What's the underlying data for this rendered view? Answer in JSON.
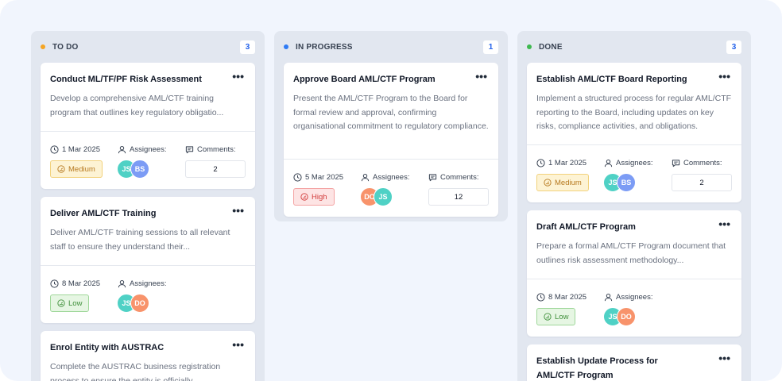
{
  "labels": {
    "assignees": "Assignees:",
    "comments": "Comments:"
  },
  "colors": {
    "todo": "#f5a524",
    "in_progress": "#2f7bf5",
    "done": "#3fb950",
    "avatar_js": "#4fd1c5",
    "avatar_bs": "#7c9cf5",
    "avatar_do": "#f8936b"
  },
  "columns": [
    {
      "title": "TO DO",
      "count": "3",
      "cards": [
        {
          "title": "Conduct ML/TF/PF Risk Assessment",
          "description": "Develop a comprehensive AML/CTF training program that outlines key regulatory obligatio...",
          "date": "1 Mar 2025",
          "priority": "Medium",
          "assignees": [
            "JS",
            "BS"
          ],
          "comments": "2"
        },
        {
          "title": "Deliver AML/CTF Training",
          "description": "Deliver AML/CTF training sessions to all relevant staff to ensure they understand their...",
          "date": "8 Mar 2025",
          "priority": "Low",
          "assignees": [
            "JS",
            "DO"
          ]
        },
        {
          "title": "Enrol Entity with AUSTRAC",
          "description": "Complete the AUSTRAC business registration process to ensure the entity is officially..."
        }
      ]
    },
    {
      "title": "IN PROGRESS",
      "count": "1",
      "cards": [
        {
          "title": "Approve Board AML/CTF Program",
          "description": "Present the AML/CTF Program to the Board for formal review and approval, confirming organisational commitment to regulatory compliance.",
          "date": "5 Mar 2025",
          "priority": "High",
          "assignees": [
            "DO",
            "JS"
          ],
          "comments": "12"
        }
      ]
    },
    {
      "title": "DONE",
      "count": "3",
      "cards": [
        {
          "title": "Establish AML/CTF Board Reporting",
          "description": "Implement a structured process for regular AML/CTF reporting to the Board, including updates on key risks, compliance activities, and obligations.",
          "date": "1 Mar 2025",
          "priority": "Medium",
          "assignees": [
            "JS",
            "BS"
          ],
          "comments": "2"
        },
        {
          "title": "Draft AML/CTF Program",
          "description": "Prepare a formal AML/CTF Program document that outlines risk assessment methodology...",
          "date": "8 Mar 2025",
          "priority": "Low",
          "assignees": [
            "JS",
            "DO"
          ]
        },
        {
          "title": "Establish Update Process for AML/CTF Program"
        }
      ]
    }
  ]
}
